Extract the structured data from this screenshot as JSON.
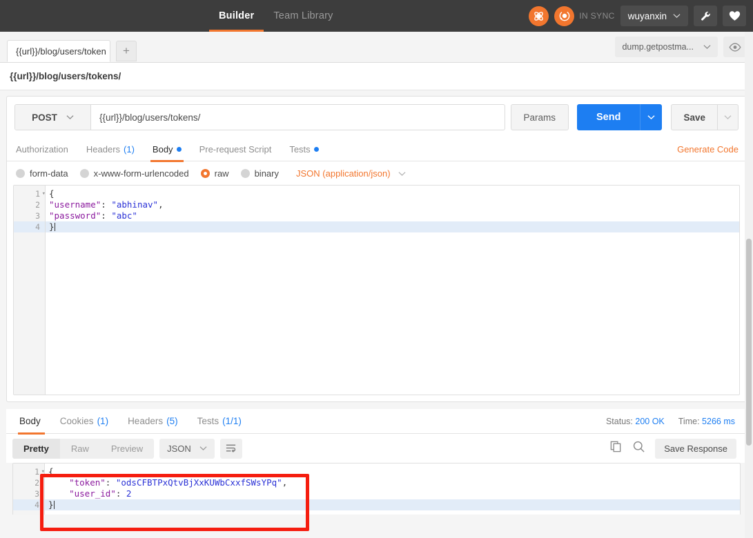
{
  "topbar": {
    "nav": [
      {
        "label": "Builder",
        "active": true
      },
      {
        "label": "Team Library",
        "active": false
      }
    ],
    "sync_label": "IN SYNC",
    "user_name": "wuyanxin",
    "wrench_icon": "wrench-icon",
    "heart_icon": "heart-icon",
    "accent_orange": "#f2762e",
    "bg": "#3d3d3d"
  },
  "tabstrip": {
    "request_tab_label": "{{url}}/blog/users/token",
    "add_tab_label": "+",
    "environment": "dump.getpostma...",
    "eye_icon": "eye-icon"
  },
  "breadcrumb": {
    "text": "{{url}}/blog/users/tokens/"
  },
  "request": {
    "method": "POST",
    "url": "{{url}}/blog/users/tokens/",
    "params_label": "Params",
    "send_label": "Send",
    "save_label": "Save",
    "tabs": [
      {
        "label": "Authorization",
        "count": "",
        "dot": false,
        "active": false
      },
      {
        "label": "Headers",
        "count": "(1)",
        "dot": false,
        "active": false
      },
      {
        "label": "Body",
        "count": "",
        "dot": true,
        "active": true
      },
      {
        "label": "Pre-request Script",
        "count": "",
        "dot": false,
        "active": false
      },
      {
        "label": "Tests",
        "count": "",
        "dot": true,
        "active": false
      }
    ],
    "generate_code_label": "Generate Code",
    "body_types": [
      {
        "label": "form-data",
        "selected": false
      },
      {
        "label": "x-www-form-urlencoded",
        "selected": false
      },
      {
        "label": "raw",
        "selected": true
      },
      {
        "label": "binary",
        "selected": false
      }
    ],
    "raw_format": "JSON (application/json)",
    "body_lines": [
      {
        "num": "1",
        "fold": true,
        "selected": false,
        "tokens": [
          {
            "t": "{",
            "c": "p"
          }
        ]
      },
      {
        "num": "2",
        "fold": false,
        "selected": false,
        "tokens": [
          {
            "t": "\"username\"",
            "c": "k"
          },
          {
            "t": ": ",
            "c": "p"
          },
          {
            "t": "\"abhinav\"",
            "c": "s"
          },
          {
            "t": ",",
            "c": "p"
          }
        ]
      },
      {
        "num": "3",
        "fold": false,
        "selected": false,
        "tokens": [
          {
            "t": "\"password\"",
            "c": "k"
          },
          {
            "t": ": ",
            "c": "p"
          },
          {
            "t": "\"abc\"",
            "c": "s"
          }
        ]
      },
      {
        "num": "4",
        "fold": false,
        "selected": true,
        "tokens": [
          {
            "t": "}",
            "c": "p"
          }
        ]
      }
    ]
  },
  "response": {
    "tabs": [
      {
        "label": "Body",
        "count": "",
        "active": true
      },
      {
        "label": "Cookies",
        "count": "(1)",
        "active": false
      },
      {
        "label": "Headers",
        "count": "(5)",
        "active": false
      },
      {
        "label": "Tests",
        "count": "(1/1)",
        "active": false
      }
    ],
    "status_label": "Status:",
    "status_value": "200 OK",
    "time_label": "Time:",
    "time_value": "5266 ms",
    "view_modes": [
      {
        "label": "Pretty",
        "active": true
      },
      {
        "label": "Raw",
        "active": false
      },
      {
        "label": "Preview",
        "active": false
      }
    ],
    "format": "JSON",
    "wrap_icon": "word-wrap-icon",
    "copy_icon": "copy-icon",
    "search_icon": "search-icon",
    "save_response_label": "Save Response",
    "body_lines": [
      {
        "num": "1",
        "fold": true,
        "selected": false,
        "tokens": [
          {
            "t": "{",
            "c": "p"
          }
        ]
      },
      {
        "num": "2",
        "fold": false,
        "selected": false,
        "tokens": [
          {
            "t": "    ",
            "c": "p"
          },
          {
            "t": "\"token\"",
            "c": "k"
          },
          {
            "t": ": ",
            "c": "p"
          },
          {
            "t": "\"odsCFBTPxQtvBjXxKUWbCxxfSWsYPq\"",
            "c": "s"
          },
          {
            "t": ",",
            "c": "p"
          }
        ]
      },
      {
        "num": "3",
        "fold": false,
        "selected": false,
        "tokens": [
          {
            "t": "    ",
            "c": "p"
          },
          {
            "t": "\"user_id\"",
            "c": "k"
          },
          {
            "t": ": ",
            "c": "p"
          },
          {
            "t": "2",
            "c": "n"
          }
        ]
      },
      {
        "num": "4",
        "fold": false,
        "selected": true,
        "tokens": [
          {
            "t": "}",
            "c": "p"
          }
        ]
      }
    ],
    "annotation_color": "#f51d0f"
  }
}
